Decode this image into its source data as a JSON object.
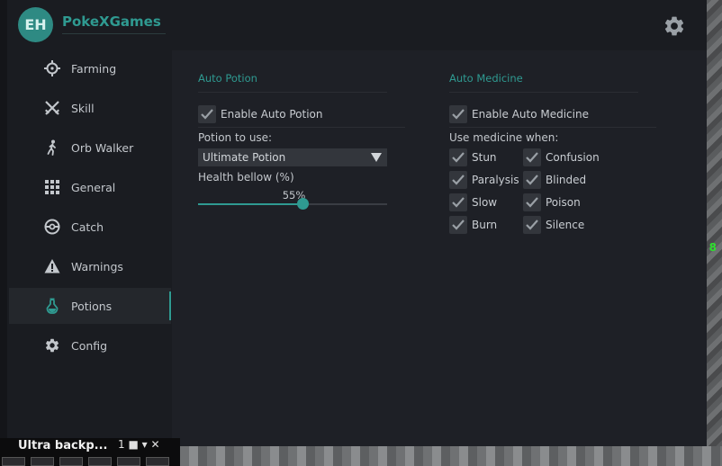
{
  "app": {
    "avatar_initials": "EH",
    "brand": "PokeXGames",
    "settings_icon": "gear-icon"
  },
  "colors": {
    "accent": "#2f9a91",
    "background": "#1a1c21",
    "panel": "#1e2026",
    "control": "#33363c"
  },
  "sidebar": {
    "items": [
      {
        "label": "Farming",
        "icon": "crosshair-icon",
        "active": false
      },
      {
        "label": "Skill",
        "icon": "crossed-swords-icon",
        "active": false
      },
      {
        "label": "Orb Walker",
        "icon": "walking-person-icon",
        "active": false
      },
      {
        "label": "General",
        "icon": "grid-icon",
        "active": false
      },
      {
        "label": "Catch",
        "icon": "pokeball-icon",
        "active": false
      },
      {
        "label": "Warnings",
        "icon": "warning-icon",
        "active": false
      },
      {
        "label": "Potions",
        "icon": "flask-icon",
        "active": true
      },
      {
        "label": "Config",
        "icon": "gear-icon",
        "active": false
      }
    ]
  },
  "auto_potion": {
    "title": "Auto Potion",
    "enable_label": "Enable Auto Potion",
    "enabled": true,
    "potion_label": "Potion to use:",
    "potion_selected": "Ultimate Potion",
    "health_label": "Health bellow (%)",
    "health_value": 55,
    "health_value_text": "55%"
  },
  "auto_medicine": {
    "title": "Auto Medicine",
    "enable_label": "Enable Auto Medicine",
    "enabled": true,
    "use_when_label": "Use medicine when:",
    "conditions": [
      {
        "label": "Stun",
        "checked": true
      },
      {
        "label": "Confusion",
        "checked": true
      },
      {
        "label": "Paralysis",
        "checked": true
      },
      {
        "label": "Blinded",
        "checked": true
      },
      {
        "label": "Slow",
        "checked": true
      },
      {
        "label": "Poison",
        "checked": true
      },
      {
        "label": "Burn",
        "checked": true
      },
      {
        "label": "Silence",
        "checked": true
      }
    ]
  },
  "taskbar": {
    "title": "Ultra backp...",
    "extra": "1 ■ ▾ ✕"
  }
}
